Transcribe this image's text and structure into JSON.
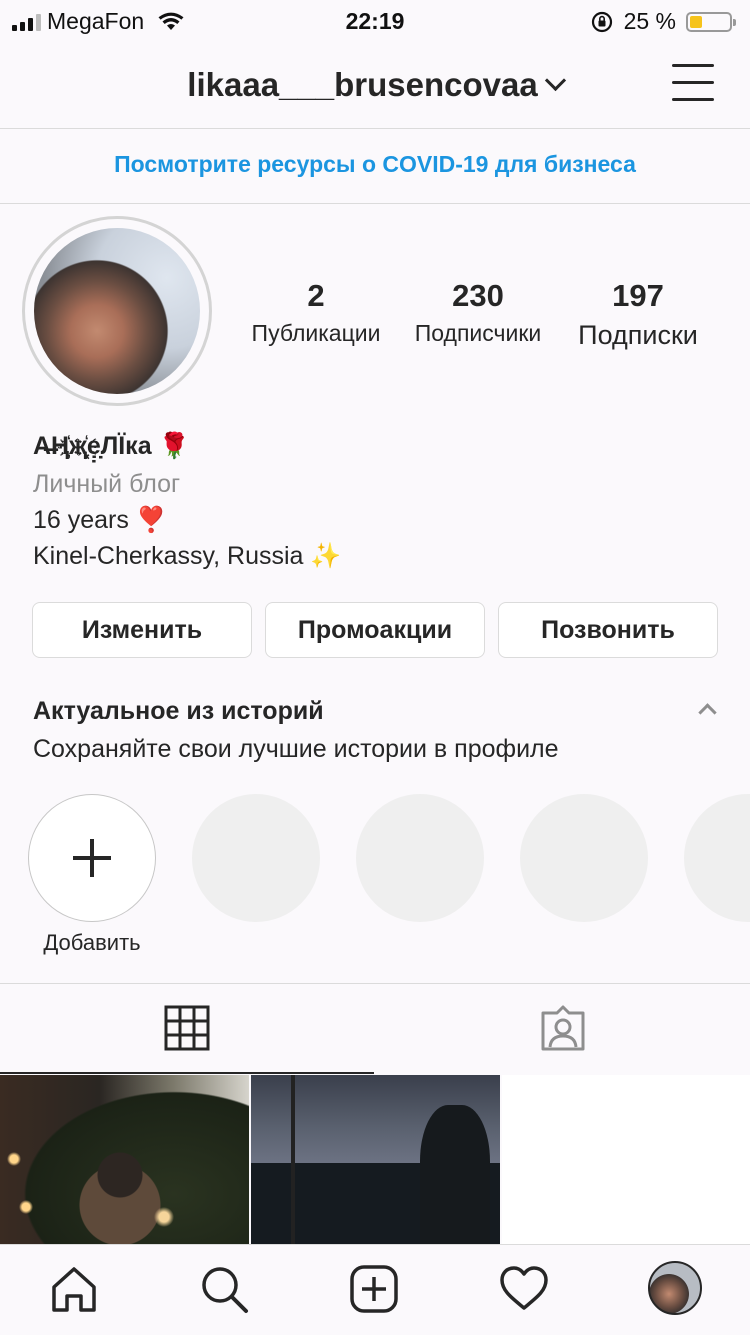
{
  "status_bar": {
    "carrier": "MegaFon",
    "time": "22:19",
    "battery_percent": "25 %",
    "battery_level": 0.25
  },
  "header": {
    "username": "likaaa___brusencovaa"
  },
  "banner": {
    "text": "Посмотрите ресурсы о COVID-19 для бизнеса"
  },
  "profile": {
    "stats": [
      {
        "value": "2",
        "label": "Публикации"
      },
      {
        "value": "230",
        "label": "Подписчики"
      },
      {
        "value": "197",
        "label": "Подписки"
      }
    ],
    "display_name": "A̶Ң҉җ͓҉ẹ̣̣̣ЛЇка 🌹",
    "category": "Личный блог",
    "bio_lines": [
      "16 years ❣️",
      "Kinel-Cherkassy, Russia ✨"
    ]
  },
  "actions": {
    "edit": "Изменить",
    "promo": "Промоакции",
    "call": "Позвонить"
  },
  "highlights": {
    "title": "Актуальное из историй",
    "subtitle": "Сохраняйте свои лучшие истории в профиле",
    "add_label": "Добавить"
  },
  "colors": {
    "link_blue": "#1b95e0",
    "text": "#262626",
    "muted": "#8e8e8e",
    "border": "#dbdbdb",
    "background": "#fbf9fc"
  },
  "icons": [
    "wifi-icon",
    "orientation-lock-icon",
    "chevron-down-icon",
    "menu-icon",
    "plus-icon",
    "grid-icon",
    "tagged-icon",
    "home-icon",
    "search-icon",
    "new-post-icon",
    "heart-icon"
  ]
}
